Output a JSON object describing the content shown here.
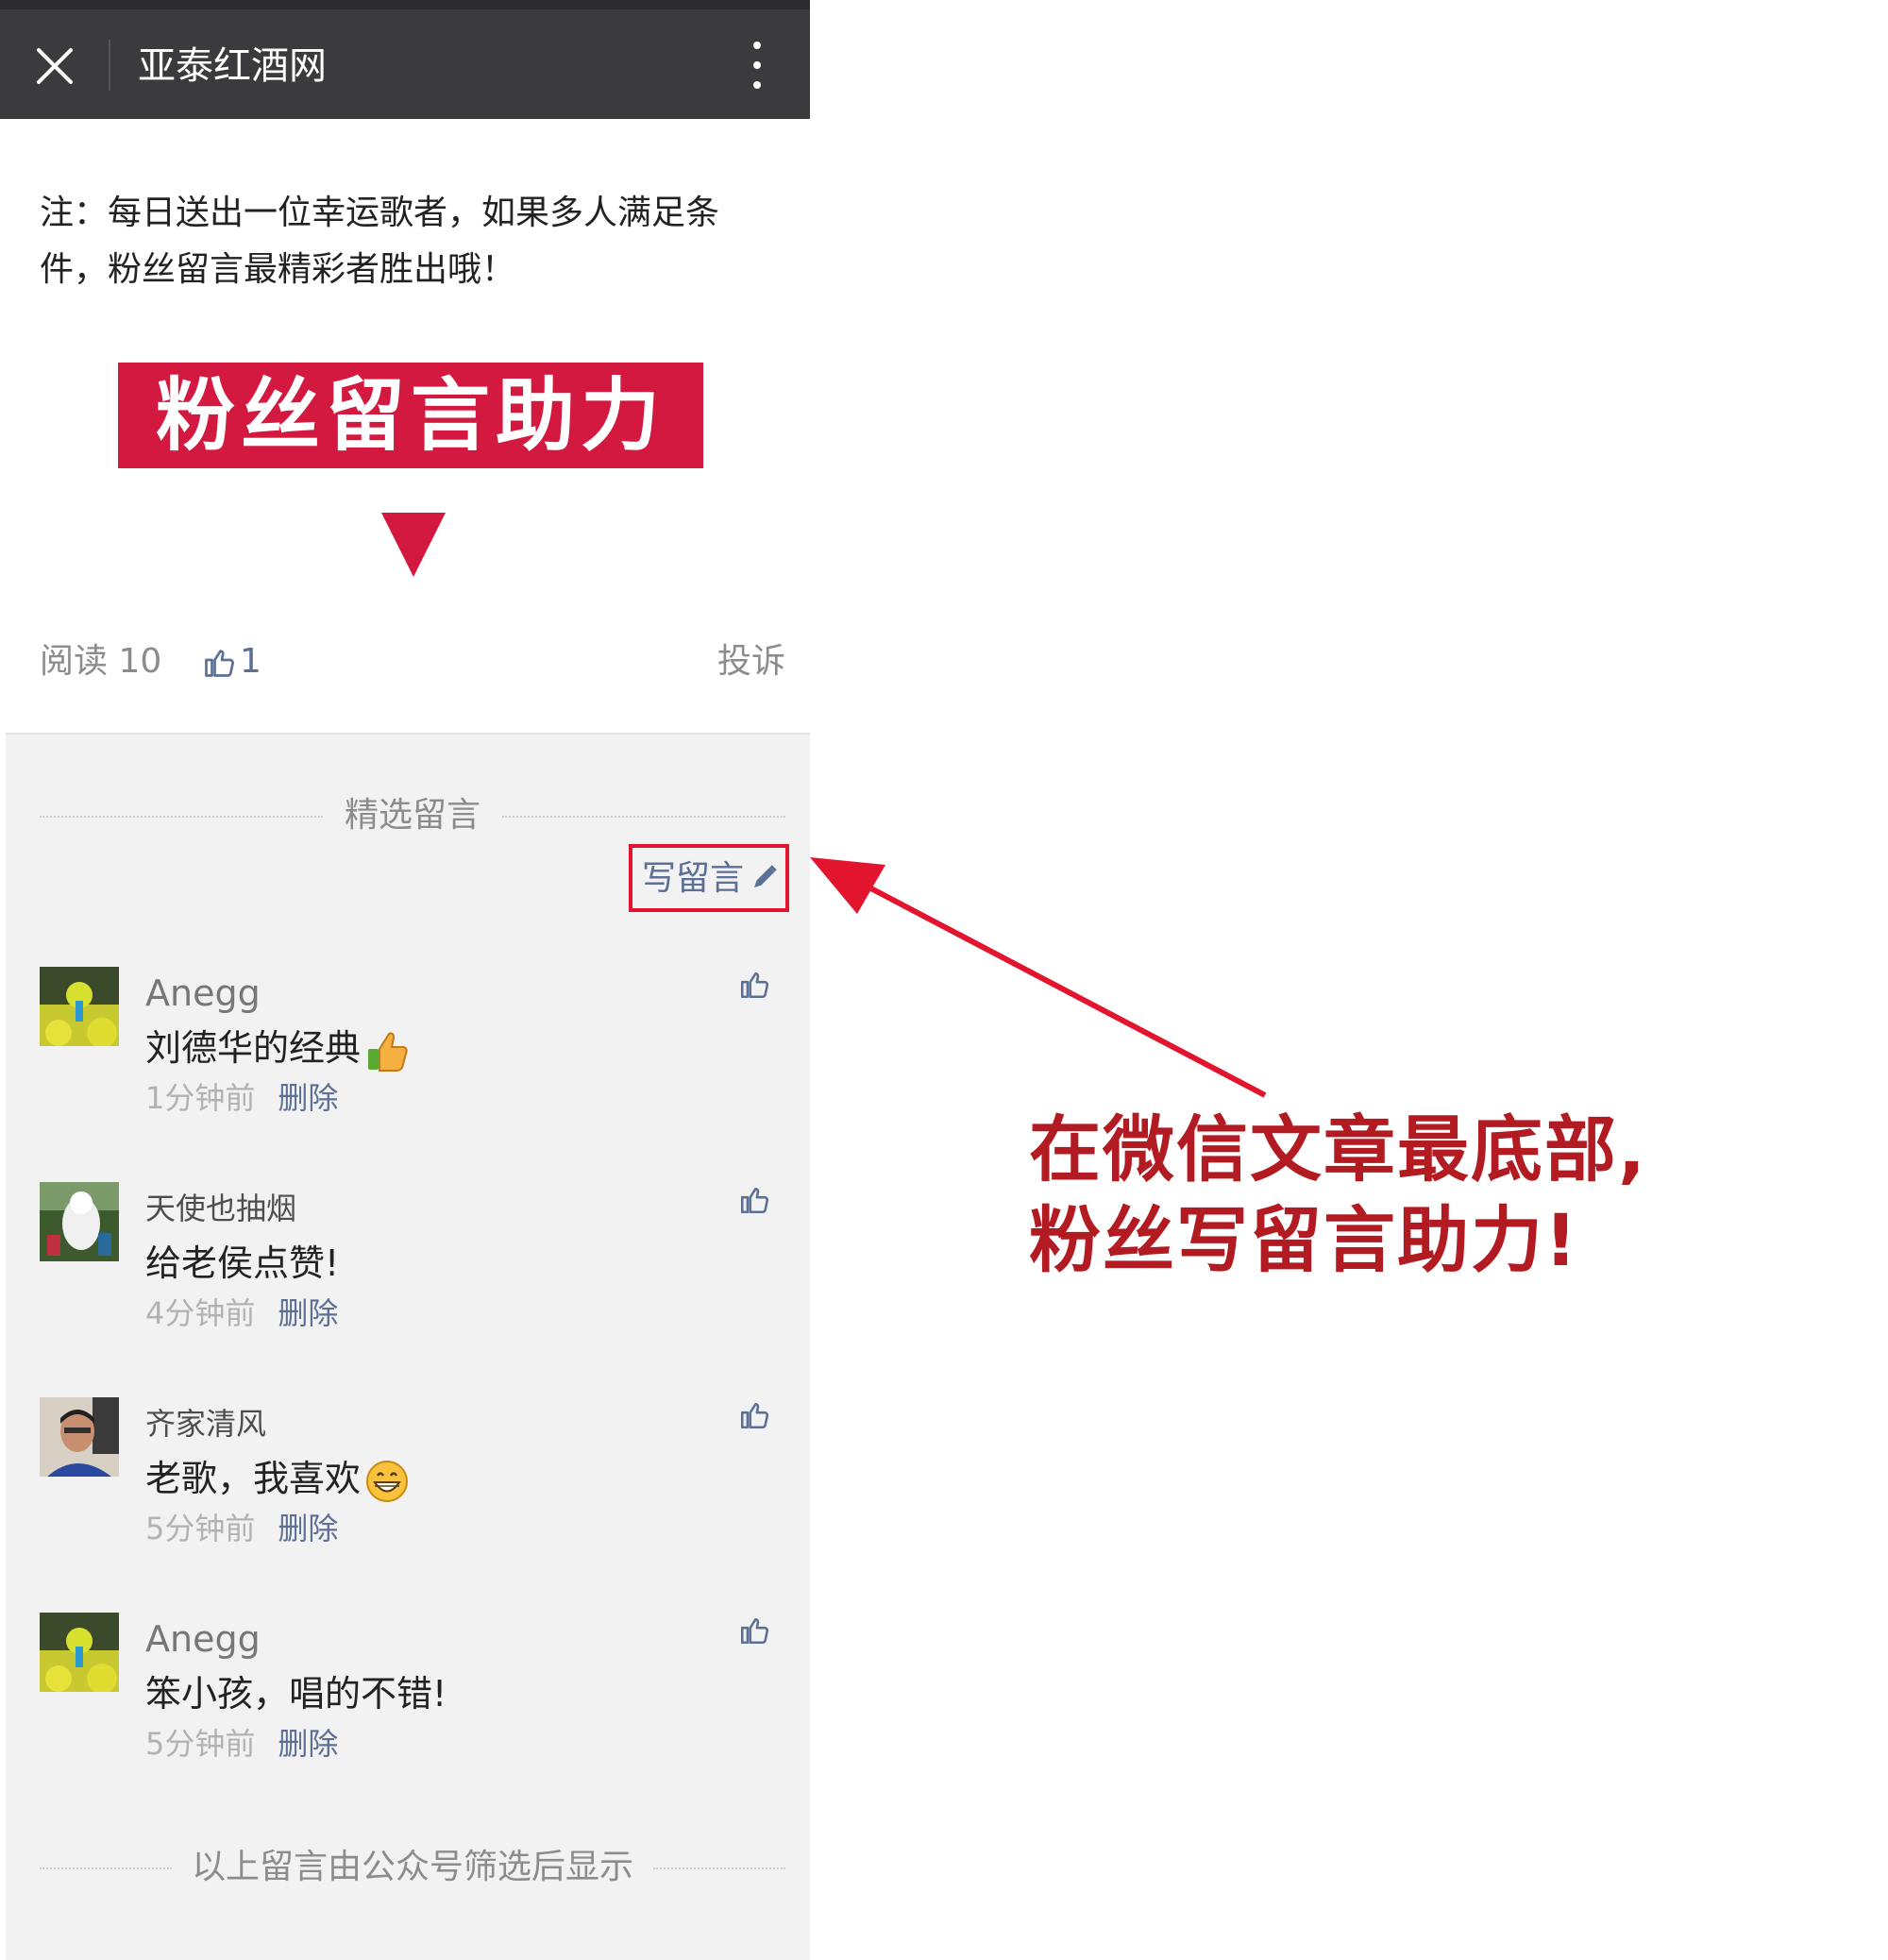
{
  "nav": {
    "title": "亚泰红酒网"
  },
  "article": {
    "note": "注：每日送出一位幸运歌者，如果多人满足条件，粉丝留言最精彩者胜出哦！",
    "banner": "粉丝留言助力",
    "read_label": "阅读 10",
    "like_count": "1",
    "report_label": "投诉"
  },
  "comments_section": {
    "title": "精选留言",
    "write_label": "写留言",
    "items": [
      {
        "nickname": "Anegg",
        "text": "刘德华的经典",
        "emoji": "thumbs-up-emoji",
        "time": "1分钟前",
        "delete": "删除"
      },
      {
        "nickname": "天使也抽烟",
        "text": "给老侯点赞!",
        "emoji": "",
        "time": "4分钟前",
        "delete": "删除"
      },
      {
        "nickname": "齐家清风",
        "text": "老歌，我喜欢",
        "emoji": "grin-emoji",
        "time": "5分钟前",
        "delete": "删除"
      },
      {
        "nickname": "Anegg",
        "text": "笨小孩，唱的不错!",
        "emoji": "",
        "time": "5分钟前",
        "delete": "删除"
      }
    ],
    "footer": "以上留言由公众号筛选后显示"
  },
  "annotation": {
    "line1": "在微信文章最底部,",
    "line2": "粉丝写留言助力!"
  },
  "colors": {
    "navbar": "#3b3b3e",
    "banner": "#d3193f",
    "link": "#5c6f95",
    "highlight_box": "#e3142e",
    "annotation": "#b31b22",
    "comments_bg": "#f2f2f2"
  }
}
